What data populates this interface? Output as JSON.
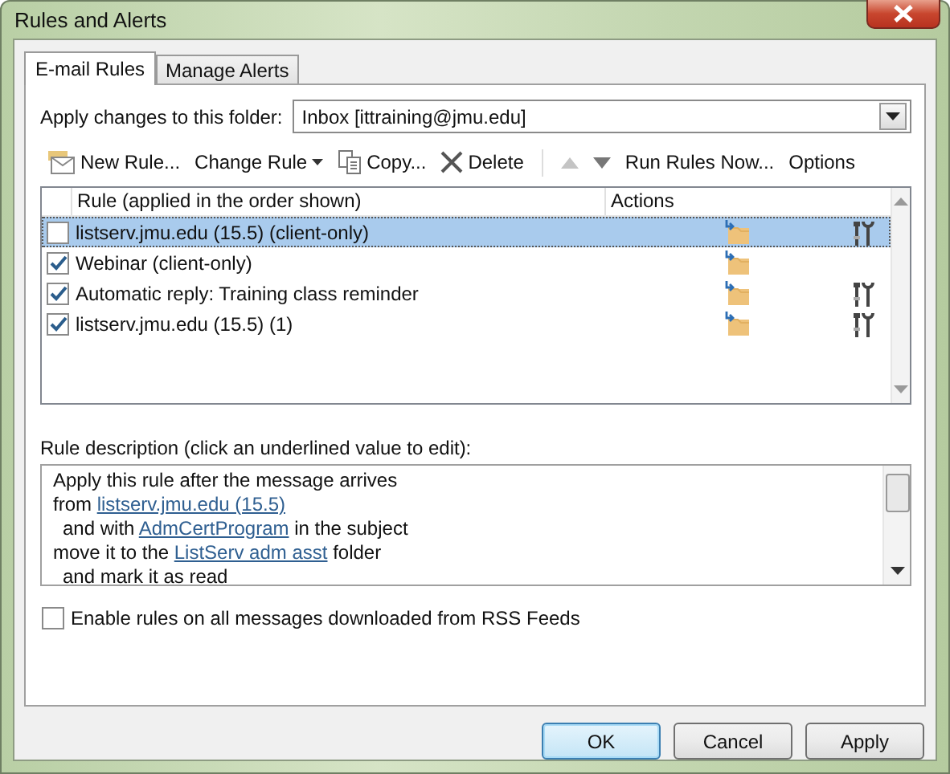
{
  "window": {
    "title": "Rules and Alerts"
  },
  "tabs": [
    {
      "label": "E-mail Rules",
      "selected": true
    },
    {
      "label": "Manage Alerts",
      "selected": false
    }
  ],
  "folder": {
    "label": "Apply changes to this folder:",
    "value": "Inbox [ittraining@jmu.edu]"
  },
  "toolbar": [
    {
      "kind": "new",
      "label": "New Rule..."
    },
    {
      "kind": "change",
      "label": "Change Rule"
    },
    {
      "kind": "copy",
      "label": "Copy..."
    },
    {
      "kind": "delete",
      "label": "Delete"
    },
    {
      "kind": "up",
      "disabled": true
    },
    {
      "kind": "down",
      "disabled": false
    },
    {
      "kind": "run",
      "label": "Run Rules Now..."
    },
    {
      "kind": "options",
      "label": "Options"
    }
  ],
  "rules": {
    "columns": [
      "Rule (applied in the order shown)",
      "Actions"
    ],
    "rows": [
      {
        "name": "listserv.jmu.edu (15.5)  (client-only)",
        "checked": false,
        "selected": true,
        "tools_icon": true
      },
      {
        "name": "Webinar  (client-only)",
        "checked": true,
        "selected": false,
        "tools_icon": false
      },
      {
        "name": "Automatic reply: Training class reminder",
        "checked": true,
        "selected": false,
        "tools_icon": true
      },
      {
        "name": "listserv.jmu.edu (15.5) (1)",
        "checked": true,
        "selected": false,
        "tools_icon": true
      }
    ]
  },
  "description": {
    "label": "Rule description (click an underlined value to edit):",
    "lines": [
      {
        "indent": false,
        "parts": [
          {
            "text": "Apply this rule after the message arrives",
            "link": false
          }
        ]
      },
      {
        "indent": false,
        "parts": [
          {
            "text": "from ",
            "link": false
          },
          {
            "text": "listserv.jmu.edu (15.5)",
            "link": true
          }
        ]
      },
      {
        "indent": true,
        "parts": [
          {
            "text": "and with ",
            "link": false
          },
          {
            "text": "AdmCertProgram",
            "link": true
          },
          {
            "text": " in the subject",
            "link": false
          }
        ]
      },
      {
        "indent": false,
        "parts": [
          {
            "text": "move it to the ",
            "link": false
          },
          {
            "text": "ListServ adm asst",
            "link": true
          },
          {
            "text": " folder",
            "link": false
          }
        ]
      },
      {
        "indent": true,
        "parts": [
          {
            "text": "and mark it as read",
            "link": false
          }
        ]
      }
    ]
  },
  "rss": {
    "label": "Enable rules on all messages downloaded from RSS Feeds",
    "checked": false
  },
  "buttons": [
    {
      "label": "OK",
      "default": true
    },
    {
      "label": "Cancel",
      "default": false
    },
    {
      "label": "Apply",
      "default": false
    }
  ]
}
